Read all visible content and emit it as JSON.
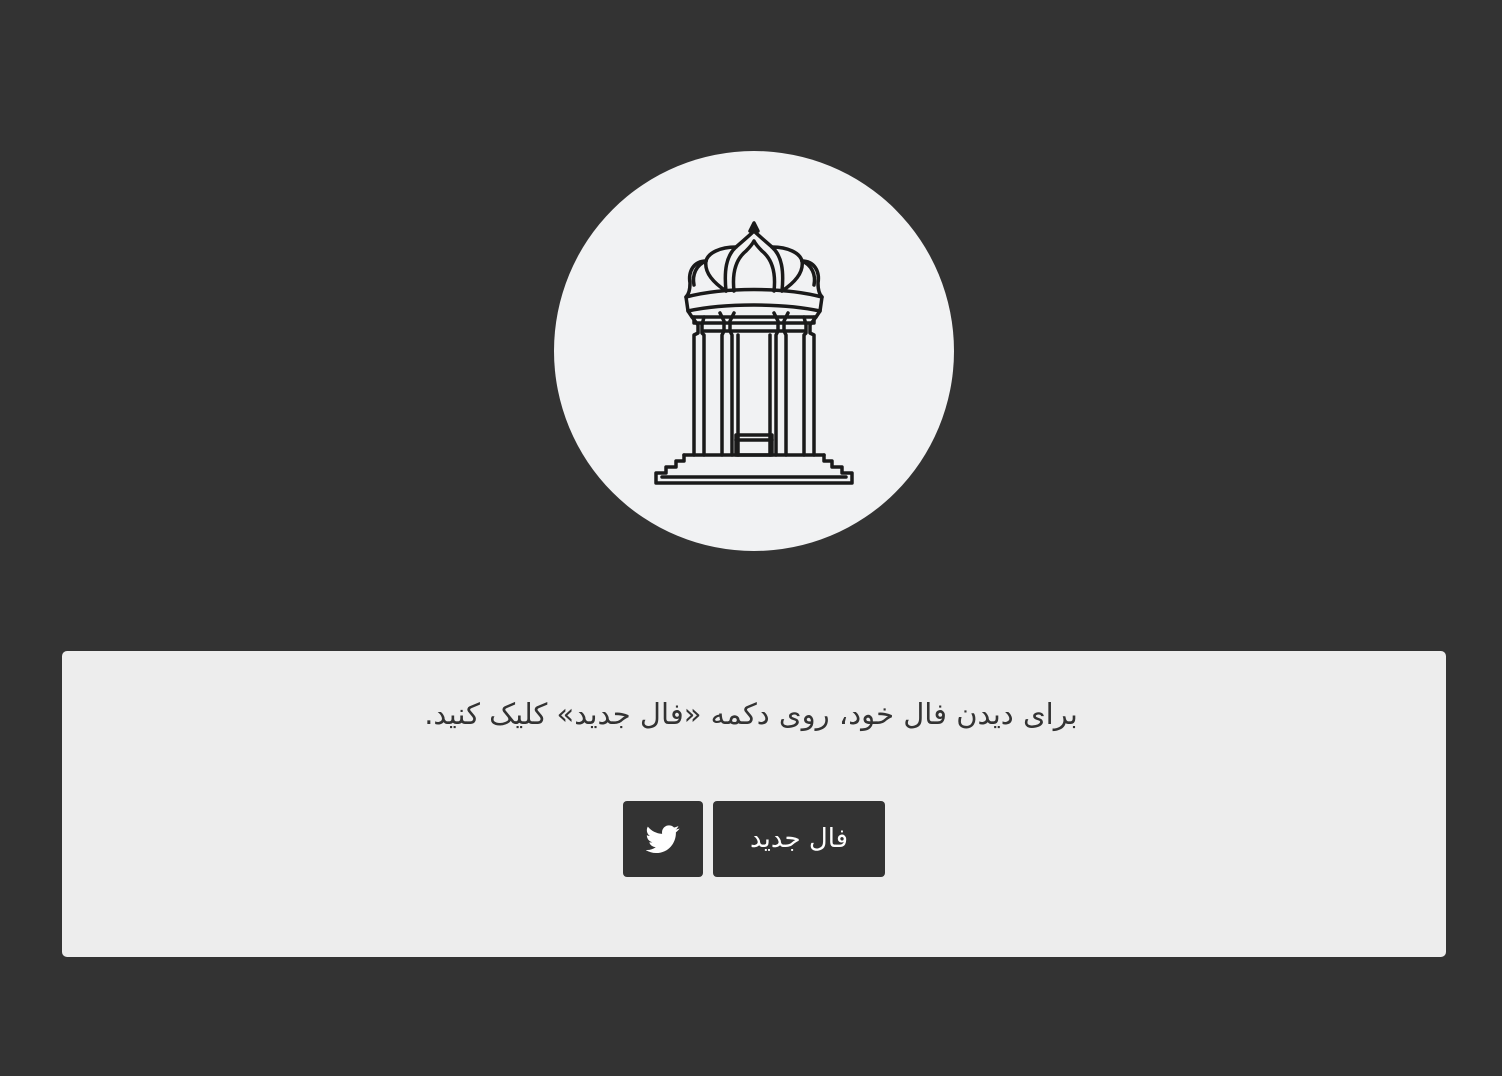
{
  "logo": {
    "icon": "hafez-tomb-icon"
  },
  "content": {
    "instruction": "برای دیدن فال خود، روی دکمه «فال جدید» کلیک کنید."
  },
  "actions": {
    "twitter_icon": "twitter-icon",
    "new_fal_label": "فال جدید"
  },
  "colors": {
    "background": "#333333",
    "panel": "#ededed",
    "circle": "#f1f2f3",
    "button": "#333333",
    "button_text": "#ffffff"
  }
}
